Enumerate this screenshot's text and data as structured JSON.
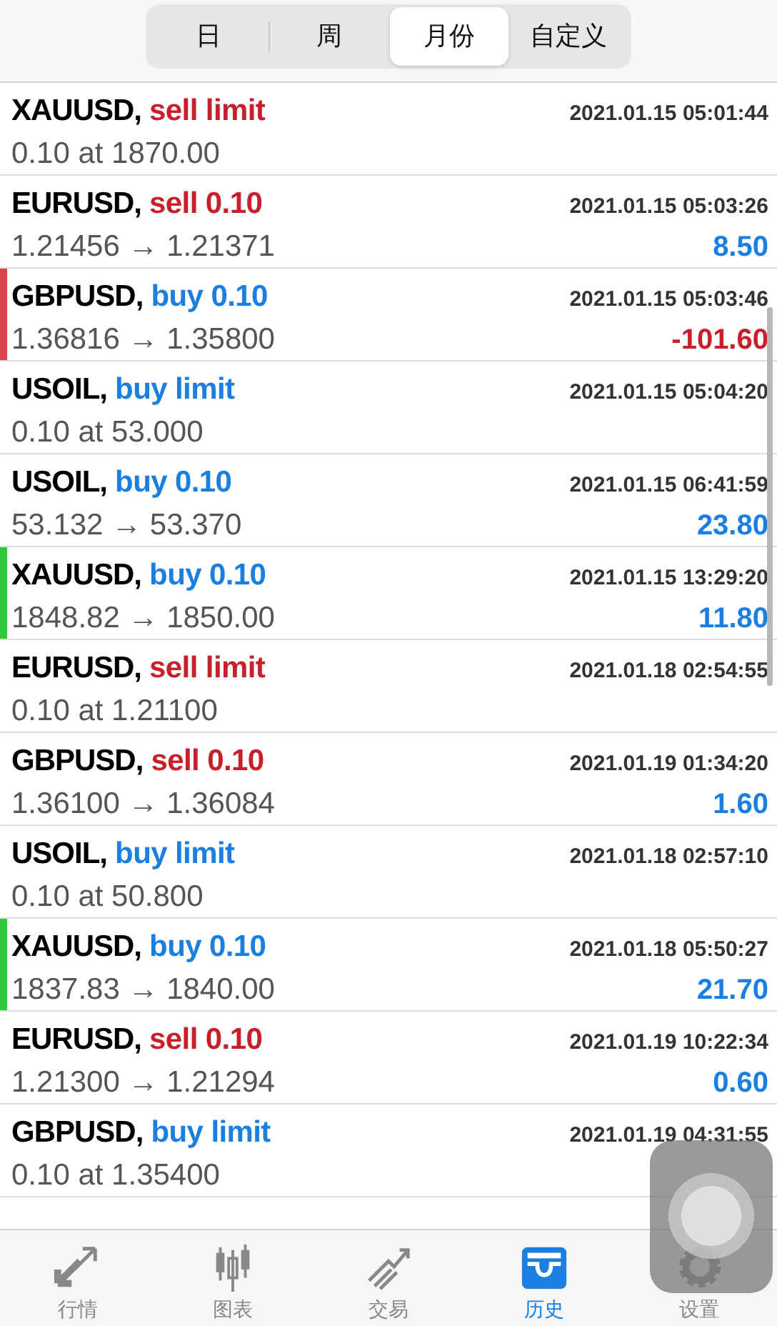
{
  "periods": [
    {
      "label": "日",
      "selected": false
    },
    {
      "label": "周",
      "selected": false
    },
    {
      "label": "月份",
      "selected": true
    },
    {
      "label": "自定义",
      "selected": false
    }
  ],
  "orders": [
    {
      "symbol": "XAUUSD,",
      "kind": "sell",
      "action": "sell limit",
      "time": "2021.01.15 05:01:44",
      "detail": "0.10 at 1870.00"
    },
    {
      "symbol": "EURUSD,",
      "kind": "sell",
      "action": "sell 0.10",
      "time": "2021.01.15 05:03:26",
      "detail": "1.21456 → 1.21371",
      "profit": {
        "text": "8.50",
        "negative": false
      }
    },
    {
      "symbol": "GBPUSD,",
      "kind": "buy",
      "action": "buy 0.10",
      "time": "2021.01.15 05:03:46",
      "detail": "1.36816 → 1.35800",
      "profit": {
        "text": "-101.60",
        "negative": true
      },
      "color": "#d9434e"
    },
    {
      "symbol": "USOIL,",
      "kind": "buy",
      "action": "buy limit",
      "time": "2021.01.15 05:04:20",
      "detail": "0.10 at 53.000"
    },
    {
      "symbol": "USOIL,",
      "kind": "buy",
      "action": "buy 0.10",
      "time": "2021.01.15 06:41:59",
      "detail": "53.132 → 53.370",
      "profit": {
        "text": "23.80",
        "negative": false
      }
    },
    {
      "symbol": "XAUUSD,",
      "kind": "buy",
      "action": "buy 0.10",
      "time": "2021.01.15 13:29:20",
      "detail": "1848.82 → 1850.00",
      "profit": {
        "text": "11.80",
        "negative": false
      },
      "color": "#2fc83a"
    },
    {
      "symbol": "EURUSD,",
      "kind": "sell",
      "action": "sell limit",
      "time": "2021.01.18 02:54:55",
      "detail": "0.10 at 1.21100"
    },
    {
      "symbol": "GBPUSD,",
      "kind": "sell",
      "action": "sell 0.10",
      "time": "2021.01.19 01:34:20",
      "detail": "1.36100 → 1.36084",
      "profit": {
        "text": "1.60",
        "negative": false
      }
    },
    {
      "symbol": "USOIL,",
      "kind": "buy",
      "action": "buy limit",
      "time": "2021.01.18 02:57:10",
      "detail": "0.10 at 50.800"
    },
    {
      "symbol": "XAUUSD,",
      "kind": "buy",
      "action": "buy 0.10",
      "time": "2021.01.18 05:50:27",
      "detail": "1837.83 → 1840.00",
      "profit": {
        "text": "21.70",
        "negative": false
      },
      "color": "#2fc83a"
    },
    {
      "symbol": "EURUSD,",
      "kind": "sell",
      "action": "sell 0.10",
      "time": "2021.01.19 10:22:34",
      "detail": "1.21300 → 1.21294",
      "profit": {
        "text": "0.60",
        "negative": false
      }
    },
    {
      "symbol": "GBPUSD,",
      "kind": "buy",
      "action": "buy limit",
      "time": "2021.01.19 04:31:55",
      "detail": "0.10 at 1.35400"
    }
  ],
  "tabbar": [
    {
      "kind": "quotes",
      "label": "行情",
      "selected": false
    },
    {
      "kind": "chart",
      "label": "图表",
      "selected": false
    },
    {
      "kind": "trade",
      "label": "交易",
      "selected": false
    },
    {
      "kind": "history",
      "label": "历史",
      "selected": true
    },
    {
      "kind": "settings",
      "label": "设置",
      "selected": false
    }
  ]
}
